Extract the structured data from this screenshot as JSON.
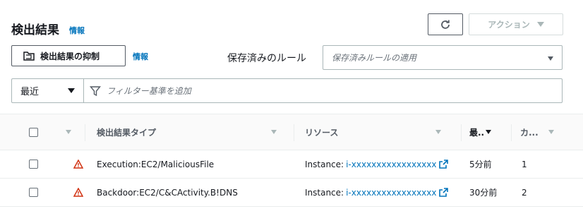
{
  "header": {
    "title": "検出結果",
    "info": "情報",
    "actions_label": "アクション"
  },
  "toolbar": {
    "suppress_label": "検出結果の抑制",
    "suppress_info": "情報",
    "saved_rules_label": "保存済みのルール",
    "saved_rules_placeholder": "保存済みルールの適用"
  },
  "filter": {
    "range_value": "最近",
    "placeholder": "フィルター基準を追加"
  },
  "table": {
    "columns": {
      "type": "検出結果タイプ",
      "resource": "リソース",
      "last_seen": "最..",
      "count": "カ..."
    },
    "rows": [
      {
        "type": "Execution:EC2/MaliciousFile",
        "resource_prefix": "Instance: ",
        "resource_id": "i-xxxxxxxxxxxxxxxxx",
        "last_seen": "5分前",
        "count": "1"
      },
      {
        "type": "Backdoor:EC2/C&CActivity.B!DNS",
        "resource_prefix": "Instance: ",
        "resource_id": "i-xxxxxxxxxxxxxxxxx",
        "last_seen": "30分前",
        "count": "2"
      }
    ]
  },
  "colors": {
    "link": "#0073bb",
    "warning": "#d13212",
    "border": "#aab7b8"
  }
}
